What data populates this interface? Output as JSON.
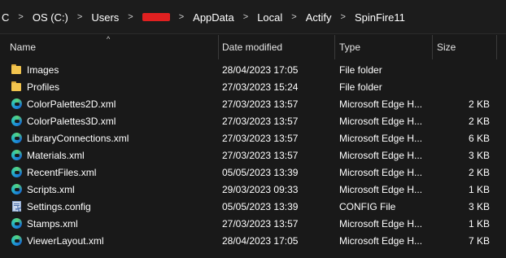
{
  "breadcrumb": {
    "items": [
      "C",
      "OS (C:)",
      "Users",
      "AppData",
      "Local",
      "Actify",
      "SpinFire11"
    ],
    "separator": ">"
  },
  "columns": {
    "name": "Name",
    "date": "Date modified",
    "type": "Type",
    "size": "Size",
    "sort_indicator": "^"
  },
  "files": [
    {
      "icon": "folder-icon",
      "name": "Images",
      "date": "28/04/2023 17:05",
      "type": "File folder",
      "size": ""
    },
    {
      "icon": "folder-icon",
      "name": "Profiles",
      "date": "27/03/2023 15:24",
      "type": "File folder",
      "size": ""
    },
    {
      "icon": "edge-icon",
      "name": "ColorPalettes2D.xml",
      "date": "27/03/2023 13:57",
      "type": "Microsoft Edge H...",
      "size": "2 KB"
    },
    {
      "icon": "edge-icon",
      "name": "ColorPalettes3D.xml",
      "date": "27/03/2023 13:57",
      "type": "Microsoft Edge H...",
      "size": "2 KB"
    },
    {
      "icon": "edge-icon",
      "name": "LibraryConnections.xml",
      "date": "27/03/2023 13:57",
      "type": "Microsoft Edge H...",
      "size": "6 KB"
    },
    {
      "icon": "edge-icon",
      "name": "Materials.xml",
      "date": "27/03/2023 13:57",
      "type": "Microsoft Edge H...",
      "size": "3 KB"
    },
    {
      "icon": "edge-icon",
      "name": "RecentFiles.xml",
      "date": "05/05/2023 13:39",
      "type": "Microsoft Edge H...",
      "size": "2 KB"
    },
    {
      "icon": "edge-icon",
      "name": "Scripts.xml",
      "date": "29/03/2023 09:33",
      "type": "Microsoft Edge H...",
      "size": "1 KB"
    },
    {
      "icon": "config-file-icon",
      "name": "Settings.config",
      "date": "05/05/2023 13:39",
      "type": "CONFIG File",
      "size": "3 KB"
    },
    {
      "icon": "edge-icon",
      "name": "Stamps.xml",
      "date": "27/03/2023 13:57",
      "type": "Microsoft Edge H...",
      "size": "1 KB"
    },
    {
      "icon": "edge-icon",
      "name": "ViewerLayout.xml",
      "date": "28/04/2023 17:05",
      "type": "Microsoft Edge H...",
      "size": "7 KB"
    }
  ],
  "colors": {
    "background": "#191919",
    "text": "#ffffff",
    "folder": "#f2c44e",
    "edge_blue": "#1c8fd8",
    "redaction": "#e02020"
  }
}
